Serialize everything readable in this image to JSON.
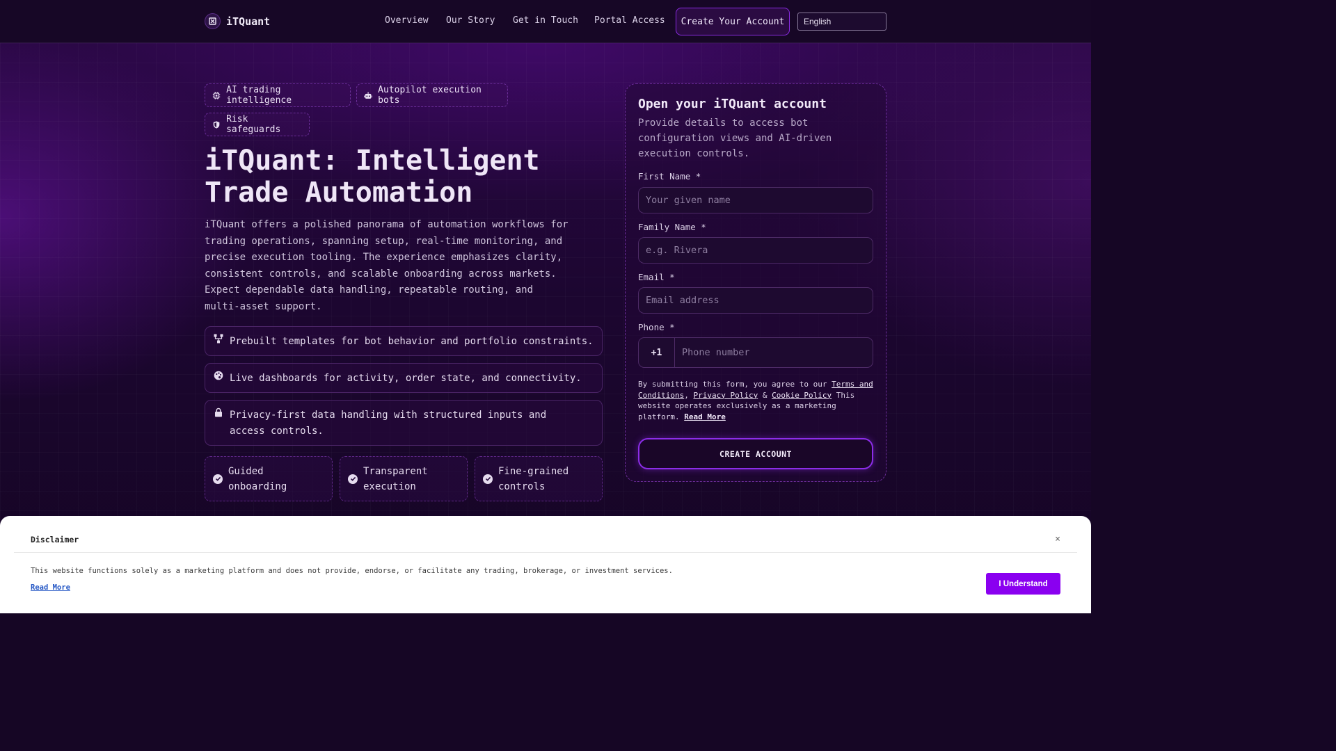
{
  "header": {
    "brand": "iTQuant",
    "nav": [
      "Overview",
      "Our Story",
      "Get in Touch",
      "Portal Access"
    ],
    "create_account": "Create Your Account",
    "language": "English"
  },
  "hero": {
    "chips": [
      {
        "label": "AI trading intelligence",
        "icon": "chip-icon"
      },
      {
        "label": "Autopilot execution bots",
        "icon": "robot-icon"
      },
      {
        "label": "Risk safeguards",
        "icon": "shield-icon"
      }
    ],
    "title_line1": "iTQuant: Intelligent",
    "title_line2": "Trade Automation",
    "description": "iTQuant offers a polished panorama of automation workflows for trading operations, spanning setup, real-time monitoring, and precise execution tooling. The experience emphasizes clarity, consistent controls, and scalable onboarding across markets. Expect dependable data handling, repeatable routing, and multi-asset support.",
    "features": [
      {
        "text": "Prebuilt templates for bot behavior and portfolio constraints.",
        "icon": "hierarchy-icon"
      },
      {
        "text": "Live dashboards for activity, order state, and connectivity.",
        "icon": "palette-icon"
      },
      {
        "text": "Privacy-first data handling with structured inputs and access controls.",
        "icon": "lock-icon"
      }
    ],
    "highlights": [
      "Guided onboarding",
      "Transparent execution",
      "Fine-grained controls"
    ]
  },
  "form": {
    "title": "Open your iTQuant account",
    "subtitle": "Provide details to access bot configuration views and AI-driven execution controls.",
    "first_name_label": "First Name *",
    "first_name_placeholder": "Your given name",
    "family_name_label": "Family Name *",
    "family_name_placeholder": "e.g. Rivera",
    "email_label": "Email *",
    "email_placeholder": "Email address",
    "phone_label": "Phone *",
    "phone_code": "+1",
    "phone_placeholder": "Phone number",
    "legal_prefix": "By submitting this form, you agree to our",
    "terms": "Terms and Conditions",
    "privacy": "Privacy Policy",
    "amp": "&",
    "cookie": "Cookie Policy",
    "legal_suffix": "This website operates exclusively as a marketing platform.",
    "read_more": "Read More",
    "submit": "CREATE ACCOUNT"
  },
  "disclaimer": {
    "title": "Disclaimer",
    "close": "×",
    "text": "This website functions solely as a marketing platform and does not provide, endorse, or facilitate any trading, brokerage, or investment services.",
    "read_more": "Read More",
    "accept": "I Understand"
  },
  "colors": {
    "accent": "#8a00f0",
    "border_accent": "#8c2de8",
    "background": "#160625"
  }
}
